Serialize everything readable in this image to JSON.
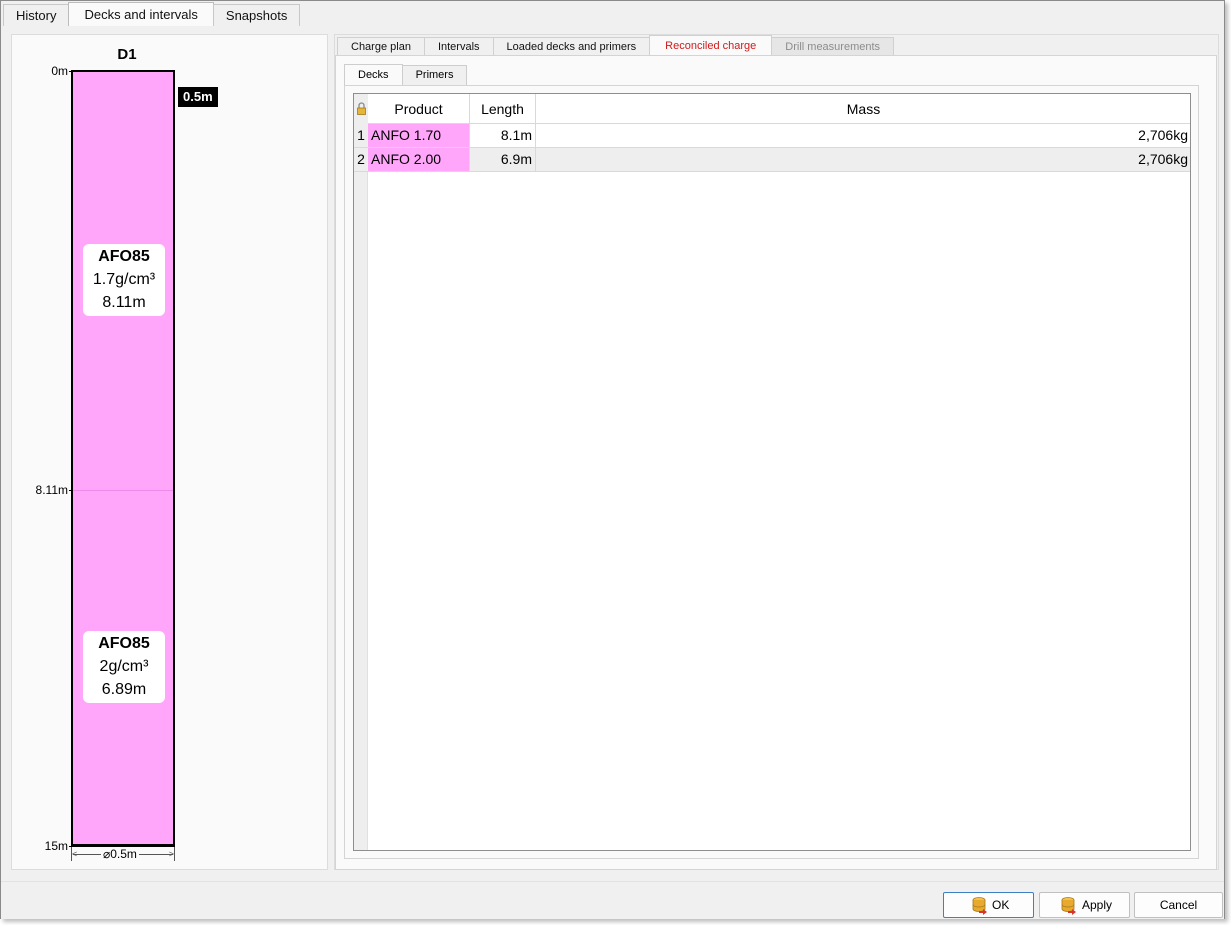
{
  "top_tabs": [
    "History",
    "Decks and intervals",
    "Snapshots"
  ],
  "top_active_tab": "Decks and intervals",
  "hole": {
    "name": "D1",
    "depth_labels": {
      "top": "0m",
      "mid": "8.11m",
      "bottom": "15m"
    },
    "stemming": "0.5m",
    "diameter": "⌀0.5m",
    "decks": [
      {
        "product": "AFO85",
        "density": "1.7g/cm³",
        "length": "8.11m",
        "color": "#ffa6fa"
      },
      {
        "product": "AFO85",
        "density": "2g/cm³",
        "length": "6.89m",
        "color": "#ffa6fa"
      }
    ]
  },
  "sub_tabs": [
    "Charge plan",
    "Intervals",
    "Loaded decks and primers",
    "Reconciled charge",
    "Drill measurements"
  ],
  "sub_active_tab": "Reconciled charge",
  "sub_disabled_tab": "Drill measurements",
  "deck_tabs": [
    "Decks",
    "Primers"
  ],
  "deck_active_tab": "Decks",
  "grid": {
    "lock_icon": "lock-icon",
    "columns": [
      "Product",
      "Length",
      "Mass"
    ],
    "rows": [
      {
        "num": "1",
        "product": "ANFO 1.70",
        "length": "8.1m",
        "mass": "2,706kg"
      },
      {
        "num": "2",
        "product": "ANFO 2.00",
        "length": "6.9m",
        "mass": "2,706kg"
      }
    ]
  },
  "buttons": {
    "ok": "OK",
    "apply": "Apply",
    "cancel": "Cancel"
  },
  "button_icons": {
    "ok": "database-save-icon",
    "apply": "database-apply-icon"
  },
  "colors": {
    "explosive": "#ffa6fa",
    "active_tab_text": "#d01a1a",
    "default_button_border": "#3f7fc4"
  }
}
